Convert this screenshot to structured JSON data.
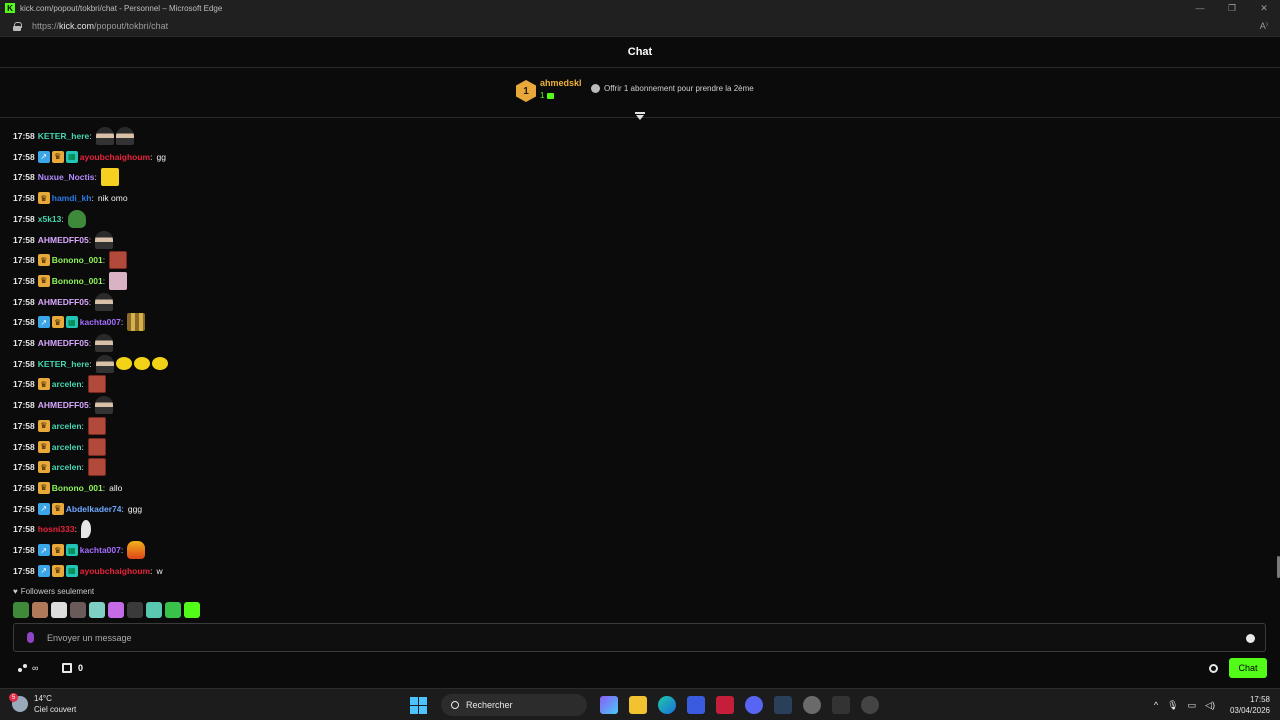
{
  "window": {
    "title": "kick.com/popout/tokbri/chat - Personnel – Microsoft Edge",
    "url_prefix": "https://",
    "url_domain": "kick.com",
    "url_path": "/popout/tokbri/chat"
  },
  "chat": {
    "heading": "Chat",
    "pinned": {
      "rank": "1",
      "username": "ahmedskl",
      "gift_count": "1",
      "offer_text": "Offrir 1 abonnement pour prendre la 2ème"
    },
    "messages": [
      {
        "time": "17:58",
        "user": "KETER_here",
        "color": "#45d6b0",
        "badges": [],
        "text": "",
        "emotes": [
          "person",
          "person"
        ]
      },
      {
        "time": "17:58",
        "user": "ayoubchaighoum",
        "color": "#e8233a",
        "badges": [
          "boost",
          "sub",
          "og"
        ],
        "text": "gg",
        "emotes": []
      },
      {
        "time": "17:58",
        "user": "Nuxue_Noctis",
        "color": "#b48cff",
        "badges": [],
        "text": "",
        "emotes": [
          "pika"
        ]
      },
      {
        "time": "17:58",
        "user": "hamdi_kh",
        "color": "#2a7ae8",
        "badges": [
          "sub"
        ],
        "text": "nik omo",
        "emotes": []
      },
      {
        "time": "17:58",
        "user": "x5k13",
        "color": "#45d6b0",
        "badges": [],
        "text": "",
        "emotes": [
          "frog"
        ]
      },
      {
        "time": "17:58",
        "user": "AHMEDFF05",
        "color": "#d9a8ff",
        "badges": [],
        "text": "",
        "emotes": [
          "person"
        ]
      },
      {
        "time": "17:58",
        "user": "Bonono_001",
        "color": "#8ff35a",
        "badges": [
          "sub"
        ],
        "text": "",
        "emotes": [
          "face"
        ]
      },
      {
        "time": "17:58",
        "user": "Bonono_001",
        "color": "#8ff35a",
        "badges": [
          "sub"
        ],
        "text": "",
        "emotes": [
          "pink"
        ]
      },
      {
        "time": "17:58",
        "user": "AHMEDFF05",
        "color": "#d9a8ff",
        "badges": [],
        "text": "",
        "emotes": [
          "person"
        ]
      },
      {
        "time": "17:58",
        "user": "kachta007",
        "color": "#a56cff",
        "badges": [
          "boost",
          "sub",
          "og"
        ],
        "text": "",
        "emotes": [
          "tiles"
        ]
      },
      {
        "time": "17:58",
        "user": "AHMEDFF05",
        "color": "#d9a8ff",
        "badges": [],
        "text": "",
        "emotes": [
          "person"
        ]
      },
      {
        "time": "17:58",
        "user": "KETER_here",
        "color": "#45d6b0",
        "badges": [],
        "text": "",
        "emotes": [
          "person",
          "bird",
          "bird",
          "bird"
        ]
      },
      {
        "time": "17:58",
        "user": "arcelen",
        "color": "#45d6b0",
        "badges": [
          "sub"
        ],
        "text": "",
        "emotes": [
          "face"
        ]
      },
      {
        "time": "17:58",
        "user": "AHMEDFF05",
        "color": "#d9a8ff",
        "badges": [],
        "text": "",
        "emotes": [
          "person"
        ]
      },
      {
        "time": "17:58",
        "user": "arcelen",
        "color": "#45d6b0",
        "badges": [
          "sub"
        ],
        "text": "",
        "emotes": [
          "face"
        ]
      },
      {
        "time": "17:58",
        "user": "arcelen",
        "color": "#45d6b0",
        "badges": [
          "sub"
        ],
        "text": "",
        "emotes": [
          "face"
        ]
      },
      {
        "time": "17:58",
        "user": "arcelen",
        "color": "#45d6b0",
        "badges": [
          "sub"
        ],
        "text": "",
        "emotes": [
          "face"
        ]
      },
      {
        "time": "17:58",
        "user": "Bonono_001",
        "color": "#8ff35a",
        "badges": [
          "sub"
        ],
        "text": "allo",
        "emotes": []
      },
      {
        "time": "17:58",
        "user": "Abdelkader74",
        "color": "#6fa8ff",
        "badges": [
          "boost",
          "sub"
        ],
        "text": "ggg",
        "emotes": []
      },
      {
        "time": "17:58",
        "user": "hosni333",
        "color": "#e8233a",
        "badges": [],
        "text": "",
        "emotes": [
          "feather"
        ]
      },
      {
        "time": "17:58",
        "user": "kachta007",
        "color": "#a56cff",
        "badges": [
          "boost",
          "sub",
          "og"
        ],
        "text": "",
        "emotes": [
          "fire"
        ]
      },
      {
        "time": "17:58",
        "user": "ayoubchaighoum",
        "color": "#e8233a",
        "badges": [
          "boost",
          "sub",
          "og"
        ],
        "text": "w",
        "emotes": []
      }
    ],
    "followers_only": "Followers seulement",
    "input_placeholder": "Envoyer un message",
    "points_symbol": "∞",
    "store_count": "0",
    "send_label": "Chat"
  },
  "taskbar": {
    "temperature": "14°C",
    "weather": "Ciel couvert",
    "weather_badge": "5",
    "search_label": "Rechercher",
    "time": "17:58",
    "date": "03/04/2026"
  },
  "colors": {
    "accent": "#53fc18",
    "background": "#0b0b0c"
  }
}
